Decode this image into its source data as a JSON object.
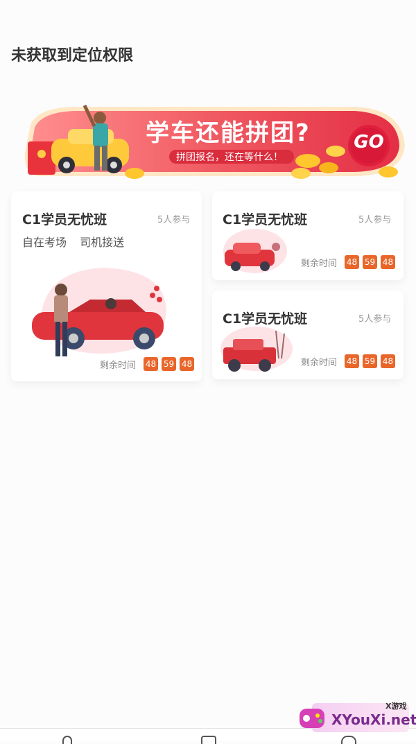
{
  "header": {
    "location_title": "未获取到定位权限"
  },
  "banner": {
    "headline": "学车还能拼团?",
    "subline": "拼团报名，还在等什么！",
    "go_label": "GO"
  },
  "cards": [
    {
      "title": "C1学员无忧班",
      "count": "5人参与",
      "tags": [
        "自在考场",
        "司机接送"
      ],
      "timer_label": "剩余时间",
      "timer": [
        "48",
        "59",
        "48"
      ]
    },
    {
      "title": "C1学员无忧班",
      "count": "5人参与",
      "timer_label": "剩余时间",
      "timer": [
        "48",
        "59",
        "48"
      ]
    },
    {
      "title": "C1学员无忧班",
      "count": "5人参与",
      "timer_label": "剩余时间",
      "timer": [
        "48",
        "59",
        "48"
      ]
    }
  ],
  "watermark": {
    "brand": "XYouXi.net",
    "tag": "X游戏"
  },
  "colors": {
    "accent": "#e9662a",
    "banner_red": "#e8394a",
    "car_red": "#e0353c"
  }
}
